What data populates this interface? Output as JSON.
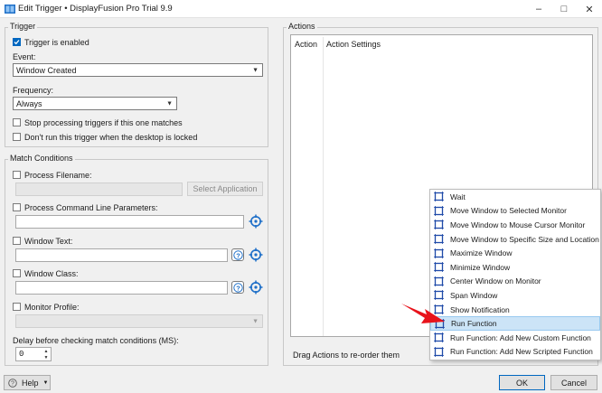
{
  "window": {
    "title": "Edit Trigger • DisplayFusion Pro Trial 9.9",
    "controls": [
      "–",
      "□",
      "✕"
    ]
  },
  "trigger": {
    "group_title": "Trigger",
    "enabled_label": "Trigger is enabled",
    "enabled_checked": true,
    "event_label": "Event:",
    "event_value": "Window Created",
    "frequency_label": "Frequency:",
    "frequency_value": "Always",
    "stop_processing_label": "Stop processing triggers if this one matches",
    "dont_run_locked_label": "Don't run this trigger when the desktop is locked"
  },
  "match": {
    "group_title": "Match Conditions",
    "process_filename_label": "Process Filename:",
    "select_application_label": "Select Application",
    "cmdline_label": "Process Command Line Parameters:",
    "window_text_label": "Window Text:",
    "window_class_label": "Window Class:",
    "monitor_profile_label": "Monitor Profile:",
    "delay_label": "Delay before checking match conditions (MS):",
    "delay_value": "0"
  },
  "actions": {
    "group_title": "Actions",
    "col_action": "Action",
    "col_settings": "Action Settings",
    "drag_hint": "Drag Actions to re-order them"
  },
  "menu": {
    "items": [
      "Wait",
      "Move Window to Selected Monitor",
      "Move Window to Mouse Cursor Monitor",
      "Move Window to Specific Size and Location",
      "Maximize Window",
      "Minimize Window",
      "Center Window on Monitor",
      "Span Window",
      "Show Notification",
      "Run Function",
      "Run Function: Add New Custom Function",
      "Run Function: Add New Scripted Function"
    ],
    "highlighted": "Run Function"
  },
  "footer": {
    "help_label": "Help",
    "ok_label": "OK",
    "cancel_label": "Cancel"
  },
  "colors": {
    "accent": "#0067c0",
    "menu_highlight": "#cce4f7",
    "arrow": "#e8131b"
  }
}
